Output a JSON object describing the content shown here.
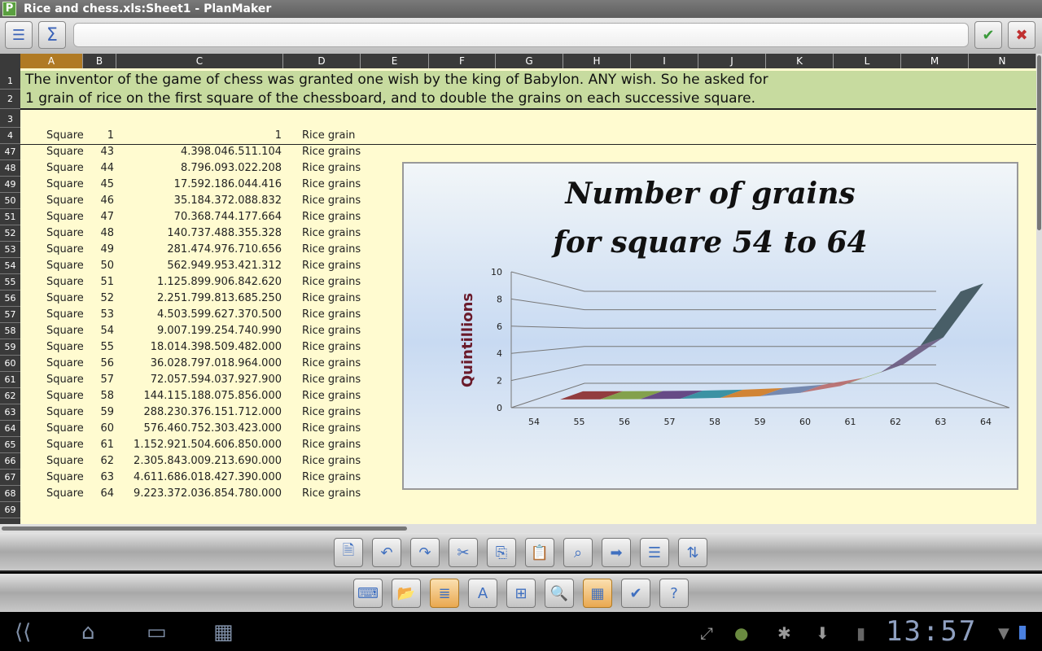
{
  "window": {
    "title": "Rice and chess.xls:Sheet1 - PlanMaker",
    "logo": "P"
  },
  "formula": {
    "value": ""
  },
  "columns": [
    "A",
    "B",
    "C",
    "D",
    "E",
    "F",
    "G",
    "H",
    "I",
    "J",
    "K",
    "L",
    "M",
    "N"
  ],
  "selected_column": "A",
  "banner": {
    "line1": "The inventor of the game of chess was granted one wish by the king of Babylon. ANY wish. So he asked for",
    "line2": "1 grain of rice on the first square of the chessboard, and to double the grains on each successive square."
  },
  "rows": [
    {
      "n": "1"
    },
    {
      "n": "2"
    },
    {
      "n": "3"
    },
    {
      "n": "4",
      "a": "Square",
      "b": "1",
      "c": "1",
      "d": "Rice grain"
    },
    {
      "n": "47",
      "a": "Square",
      "b": "43",
      "c": "4.398.046.511.104",
      "d": "Rice grains"
    },
    {
      "n": "48",
      "a": "Square",
      "b": "44",
      "c": "8.796.093.022.208",
      "d": "Rice grains"
    },
    {
      "n": "49",
      "a": "Square",
      "b": "45",
      "c": "17.592.186.044.416",
      "d": "Rice grains"
    },
    {
      "n": "50",
      "a": "Square",
      "b": "46",
      "c": "35.184.372.088.832",
      "d": "Rice grains"
    },
    {
      "n": "51",
      "a": "Square",
      "b": "47",
      "c": "70.368.744.177.664",
      "d": "Rice grains"
    },
    {
      "n": "52",
      "a": "Square",
      "b": "48",
      "c": "140.737.488.355.328",
      "d": "Rice grains"
    },
    {
      "n": "53",
      "a": "Square",
      "b": "49",
      "c": "281.474.976.710.656",
      "d": "Rice grains"
    },
    {
      "n": "54",
      "a": "Square",
      "b": "50",
      "c": "562.949.953.421.312",
      "d": "Rice grains"
    },
    {
      "n": "55",
      "a": "Square",
      "b": "51",
      "c": "1.125.899.906.842.620",
      "d": "Rice grains"
    },
    {
      "n": "56",
      "a": "Square",
      "b": "52",
      "c": "2.251.799.813.685.250",
      "d": "Rice grains"
    },
    {
      "n": "57",
      "a": "Square",
      "b": "53",
      "c": "4.503.599.627.370.500",
      "d": "Rice grains"
    },
    {
      "n": "58",
      "a": "Square",
      "b": "54",
      "c": "9.007.199.254.740.990",
      "d": "Rice grains"
    },
    {
      "n": "59",
      "a": "Square",
      "b": "55",
      "c": "18.014.398.509.482.000",
      "d": "Rice grains"
    },
    {
      "n": "60",
      "a": "Square",
      "b": "56",
      "c": "36.028.797.018.964.000",
      "d": "Rice grains"
    },
    {
      "n": "61",
      "a": "Square",
      "b": "57",
      "c": "72.057.594.037.927.900",
      "d": "Rice grains"
    },
    {
      "n": "62",
      "a": "Square",
      "b": "58",
      "c": "144.115.188.075.856.000",
      "d": "Rice grains"
    },
    {
      "n": "63",
      "a": "Square",
      "b": "59",
      "c": "288.230.376.151.712.000",
      "d": "Rice grains"
    },
    {
      "n": "64",
      "a": "Square",
      "b": "60",
      "c": "576.460.752.303.423.000",
      "d": "Rice grains"
    },
    {
      "n": "65",
      "a": "Square",
      "b": "61",
      "c": "1.152.921.504.606.850.000",
      "d": "Rice grains"
    },
    {
      "n": "66",
      "a": "Square",
      "b": "62",
      "c": "2.305.843.009.213.690.000",
      "d": "Rice grains"
    },
    {
      "n": "67",
      "a": "Square",
      "b": "63",
      "c": "4.611.686.018.427.390.000",
      "d": "Rice grains"
    },
    {
      "n": "68",
      "a": "Square",
      "b": "64",
      "c": "9.223.372.036.854.780.000",
      "d": "Rice grains"
    },
    {
      "n": "69"
    }
  ],
  "chart_data": {
    "type": "line",
    "style": "3d-ribbon",
    "title_line1": "Number of grains",
    "title_line2": "for square 54 to 64",
    "ylabel": "Quintillions",
    "xlabel": "",
    "categories": [
      "54",
      "55",
      "56",
      "57",
      "58",
      "59",
      "60",
      "61",
      "62",
      "63",
      "64"
    ],
    "values": [
      0.009,
      0.018,
      0.036,
      0.072,
      0.144,
      0.288,
      0.576,
      1.153,
      2.306,
      4.612,
      9.223
    ],
    "yticks": [
      "0",
      "2",
      "4",
      "6",
      "8",
      "10"
    ],
    "ylim": [
      0,
      10
    ],
    "grid": true,
    "segment_colors": [
      "#8b2a2a",
      "#7a9a3a",
      "#5a3a7a",
      "#2a8a9a",
      "#d07a20",
      "#6a80a8",
      "#b86a6a",
      "#8aaa50",
      "#6a5a80",
      "#3a5058"
    ]
  },
  "toolbar1": [
    "document-icon",
    "undo-icon",
    "redo-icon",
    "cut-icon",
    "copy-icon",
    "paste-icon",
    "find-icon",
    "goto-icon",
    "menu-icon",
    "sort-icon"
  ],
  "toolbar2": [
    "keyboard-icon",
    "open-icon",
    "format-icon",
    "font-icon",
    "insert-icon",
    "zoom-icon",
    "sheet-icon",
    "check-icon",
    "help-icon"
  ],
  "status": {
    "time": "13:57"
  }
}
